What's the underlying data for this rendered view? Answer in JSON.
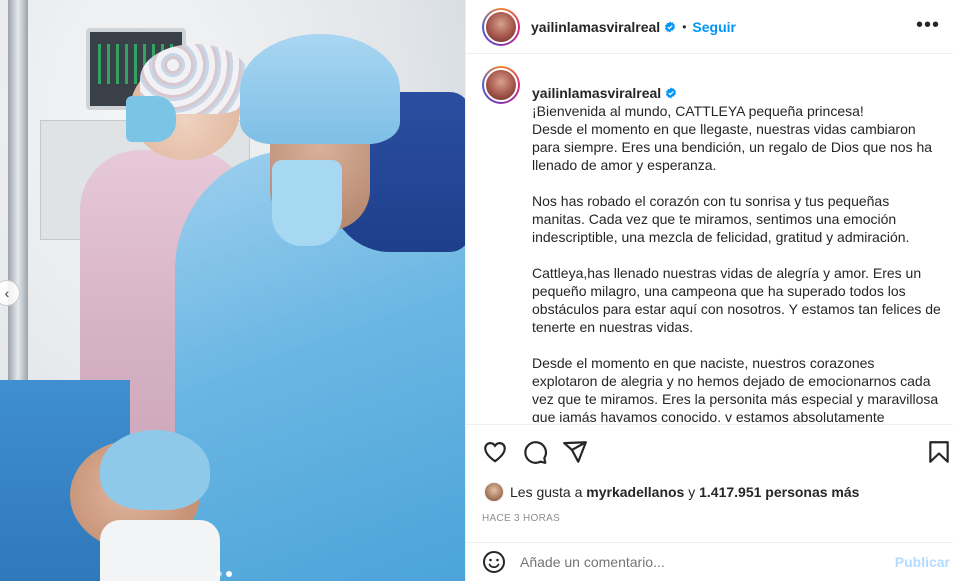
{
  "media": {
    "carousel_dots": 2,
    "active_dot": 2
  },
  "header": {
    "username": "yailinlamasviralreal",
    "separator": "•",
    "follow_label": "Seguir",
    "more_icon": "more-horizontal-icon"
  },
  "caption": {
    "username": "yailinlamasviralreal",
    "paragraphs": [
      "¡Bienvenida al mundo, CATTLEYA pequeña princesa!\nDesde el momento en que llegaste, nuestras vidas cambiaron para siempre. Eres una bendición, un regalo de Dios que nos ha llenado de amor y esperanza.",
      "Nos has robado el corazón con tu sonrisa y tus pequeñas manitas. Cada vez que te miramos, sentimos una emoción indescriptible, una mezcla de felicidad, gratitud y admiración.",
      "Cattleya,has llenado nuestras vidas de alegría y amor. Eres un pequeño milagro, una campeona que ha superado todos los obstáculos para estar aquí con nosotros. Y estamos tan felices de tenerte en nuestras vidas.",
      "Desde el momento en que naciste, nuestros corazones explotaron de alegria y no hemos dejado de emocionarnos cada vez que te miramos. Eres la personita más especial y maravillosa que jamás hayamos conocido, y estamos absolutamente agradecidos de Dios por tenerte en nuestras vidas."
    ]
  },
  "likes": {
    "prefix": "Les gusta a",
    "user": "myrkadellanos",
    "middle": "y",
    "count": "1.417.951 personas más"
  },
  "time": "HACE 3 HORAS",
  "comment": {
    "placeholder": "Añade un comentario...",
    "publish_label": "Publicar"
  },
  "colors": {
    "accent": "#0095f6",
    "publish_disabled": "#b3dbff",
    "muted": "#8e8e8e"
  }
}
